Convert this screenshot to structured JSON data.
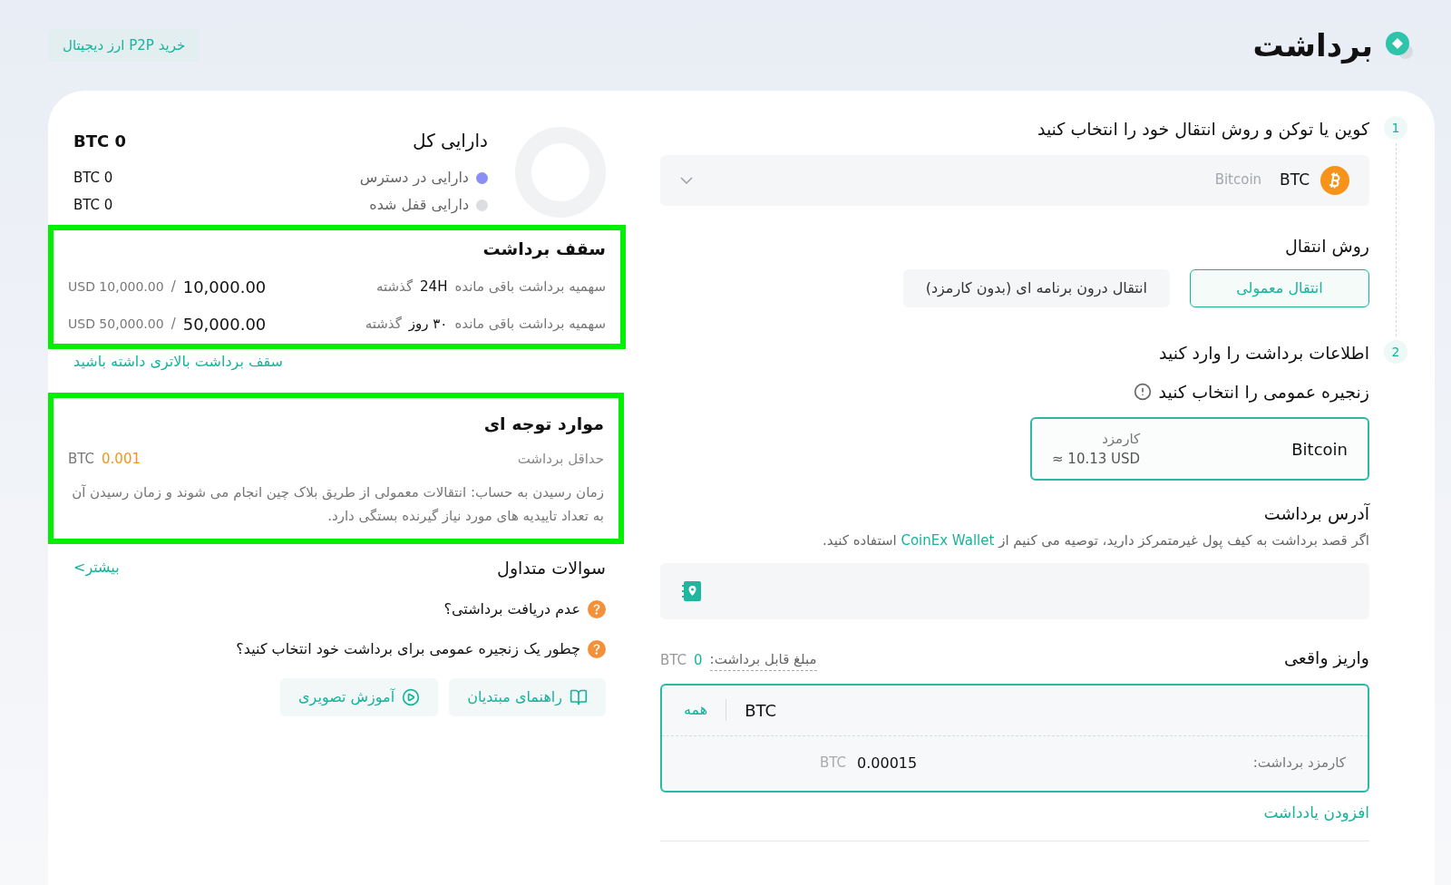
{
  "header": {
    "title": "برداشت",
    "p2p_button": "خرید P2P ارز دیجیتال"
  },
  "assets": {
    "title": "دارایی کل",
    "total": "BTC 0",
    "rows": [
      {
        "label": "دارایی در دسترس",
        "value": "BTC 0",
        "color": "#8b8ff5"
      },
      {
        "label": "دارایی قفل شده",
        "value": "BTC 0",
        "color": "#dcdde1"
      }
    ]
  },
  "limits": {
    "title": "سقف برداشت",
    "highlighted": true,
    "rows": [
      {
        "label": "سهمیه برداشت باقی مانده",
        "period": "24H",
        "suffix": "گذشته",
        "remaining": "10,000.00",
        "separator": "/",
        "limit": "USD 10,000.00"
      },
      {
        "label": "سهمیه برداشت باقی مانده",
        "period": "۳۰ روز",
        "suffix": "گذشته",
        "remaining": "50,000.00",
        "separator": "/",
        "limit": "USD 50,000.00"
      }
    ],
    "link": "سقف برداشت بالاتری داشته باشید"
  },
  "notes": {
    "title": "موارد توجه ای",
    "highlighted": true,
    "min_label": "حداقل برداشت",
    "min_value": "0.001",
    "min_unit": "BTC",
    "text": "زمان رسیدن به حساب: انتقالات معمولی از طریق بلاک چین انجام می شوند و زمان رسیدن آن به تعداد تاییدیه های مورد نیاز گیرنده بستگی دارد."
  },
  "faq": {
    "title": "سوالات متداول",
    "more": "بیشتر>",
    "questions": [
      "عدم دریافت برداشتی؟",
      "چطور یک زنجیره عمومی برای برداشت خود انتخاب کنید؟"
    ],
    "buttons": [
      {
        "label": "راهنمای مبتدیان",
        "kind": "guide"
      },
      {
        "label": "آموزش تصویری",
        "kind": "video"
      }
    ]
  },
  "step1": {
    "number": "1",
    "title": "کوین یا توکن و روش انتقال خود را انتخاب کنید"
  },
  "coin_select": {
    "symbol": "BTC",
    "name": "Bitcoin"
  },
  "transfer": {
    "title": "روش انتقال",
    "options": [
      {
        "label": "انتقال معمولی",
        "selected": true
      },
      {
        "label": "انتقال درون برنامه ای (بدون کارمزد)",
        "selected": false
      }
    ]
  },
  "step2": {
    "number": "2",
    "title": "اطلاعات برداشت را وارد کنید"
  },
  "chain": {
    "title": "زنجیره عمومی را انتخاب کنید",
    "options": [
      {
        "name": "Bitcoin",
        "fee_label": "کارمزد",
        "fee": "≈ 10.13 USD",
        "selected": true
      }
    ]
  },
  "address": {
    "title": "آدرس برداشت",
    "hint_before": "اگر قصد برداشت به کیف پول غیرمتمرکز دارید، توصیه می کنیم از",
    "hint_link": "CoinEx Wallet",
    "hint_after": "استفاده کنید."
  },
  "amount": {
    "title": "واریز واقعی",
    "available_label": "مبلغ قابل برداشت:",
    "available_value": "0",
    "available_unit": "BTC",
    "unit": "BTC",
    "all_button": "همه",
    "fee_label": "کارمزد برداشت:",
    "fee_value": "0.00015",
    "fee_unit": "BTC"
  },
  "add_note": "افزودن یادداشت"
}
